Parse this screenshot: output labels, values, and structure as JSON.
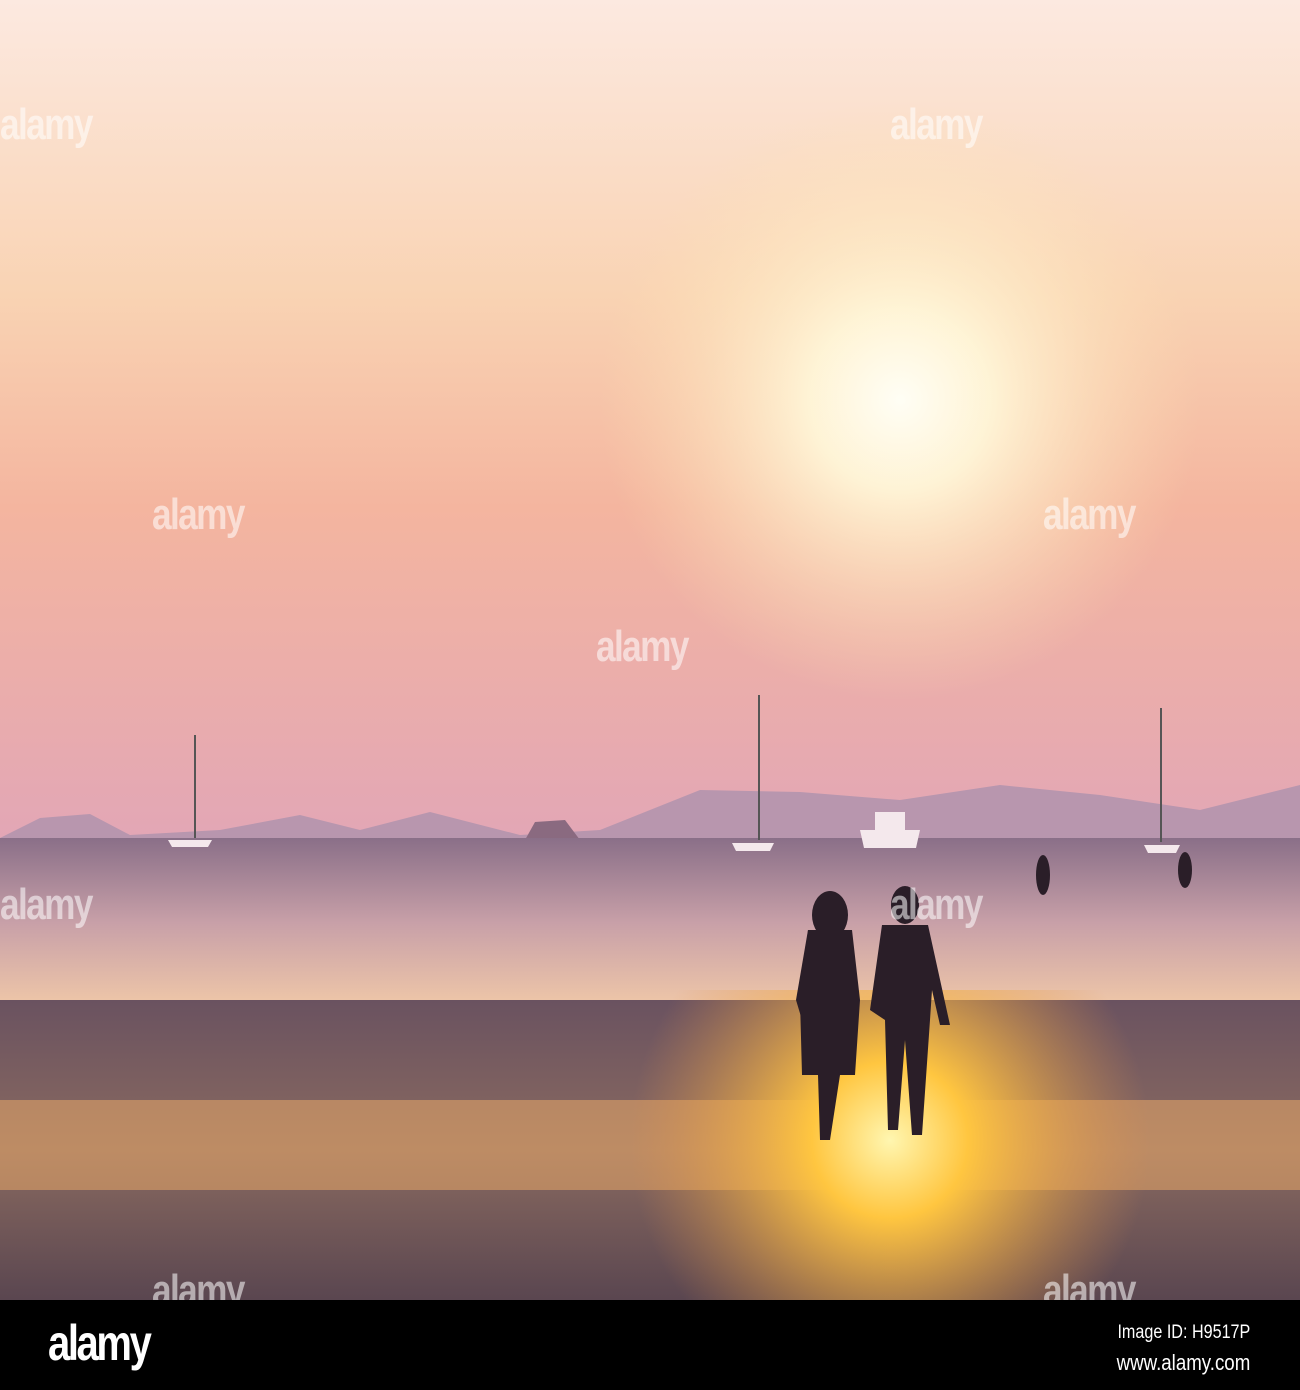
{
  "photo": {
    "subject": "couple-walking-on-beach-at-sunset",
    "colors": {
      "sky_top": "#fbe6dc",
      "sky_mid": "#f7c8a6",
      "sky_horizon": "#e7a8b6",
      "sun": "#fffbe8",
      "sea": "#c89aa0",
      "sand": "#5a4650",
      "glow": "#ffc640"
    }
  },
  "watermark": {
    "text": "alamy"
  },
  "footer": {
    "logo": "alamy",
    "image_id": "Image ID: H9517P",
    "website": "www.alamy.com"
  }
}
